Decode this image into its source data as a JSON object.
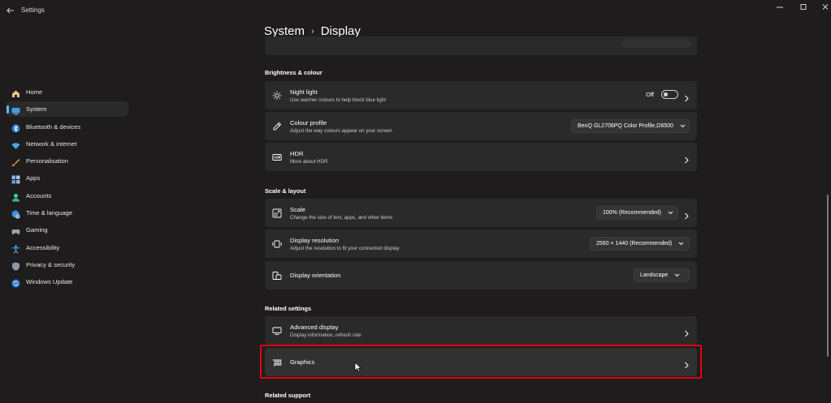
{
  "window": {
    "title": "Settings",
    "controls": [
      "minimize-icon",
      "maximize-icon",
      "close-icon"
    ]
  },
  "sidebar": {
    "items": [
      {
        "label": "Home",
        "icon": "home-icon",
        "active": false
      },
      {
        "label": "System",
        "icon": "system-display-icon",
        "active": true
      },
      {
        "label": "Bluetooth & devices",
        "icon": "bluetooth-icon",
        "active": false
      },
      {
        "label": "Network & internet",
        "icon": "wifi-icon",
        "active": false
      },
      {
        "label": "Personalisation",
        "icon": "brush-icon",
        "active": false
      },
      {
        "label": "Apps",
        "icon": "apps-icon",
        "active": false
      },
      {
        "label": "Accounts",
        "icon": "accounts-icon",
        "active": false
      },
      {
        "label": "Time & language",
        "icon": "globe-clock-icon",
        "active": false
      },
      {
        "label": "Gaming",
        "icon": "gamepad-icon",
        "active": false
      },
      {
        "label": "Accessibility",
        "icon": "accessibility-icon",
        "active": false
      },
      {
        "label": "Privacy & security",
        "icon": "shield-icon",
        "active": false
      },
      {
        "label": "Windows Update",
        "icon": "update-icon",
        "active": false
      }
    ]
  },
  "breadcrumb": {
    "parent": "System",
    "separator": "›",
    "current": "Display"
  },
  "sections": {
    "brightness": {
      "heading": "Brightness & colour",
      "night_light": {
        "title": "Night light",
        "subtitle": "Use warmer colours to help block blue light",
        "state": "Off"
      },
      "colour_profile": {
        "title": "Colour profile",
        "subtitle": "Adjust the way colours appear on your screen",
        "value": "BenQ GL2706PQ Color Profile,D6500"
      },
      "hdr": {
        "title": "HDR",
        "subtitle": "More about HDR"
      }
    },
    "scale_layout": {
      "heading": "Scale & layout",
      "scale": {
        "title": "Scale",
        "subtitle": "Change the size of text, apps, and other items",
        "value": "100% (Recommended)"
      },
      "resolution": {
        "title": "Display resolution",
        "subtitle": "Adjust the resolution to fit your connected display",
        "value": "2560 × 1440 (Recommended)"
      },
      "orientation": {
        "title": "Display orientation",
        "value": "Landscape"
      }
    },
    "related_settings": {
      "heading": "Related settings",
      "advanced": {
        "title": "Advanced display",
        "subtitle": "Display information, refresh rate"
      },
      "graphics": {
        "title": "Graphics"
      }
    },
    "related_support": {
      "heading": "Related support"
    }
  },
  "colors": {
    "background": "#1e1c1c",
    "card": "#2b2a2a",
    "accent": "#4cc2ff",
    "highlight": "#e4000f"
  }
}
